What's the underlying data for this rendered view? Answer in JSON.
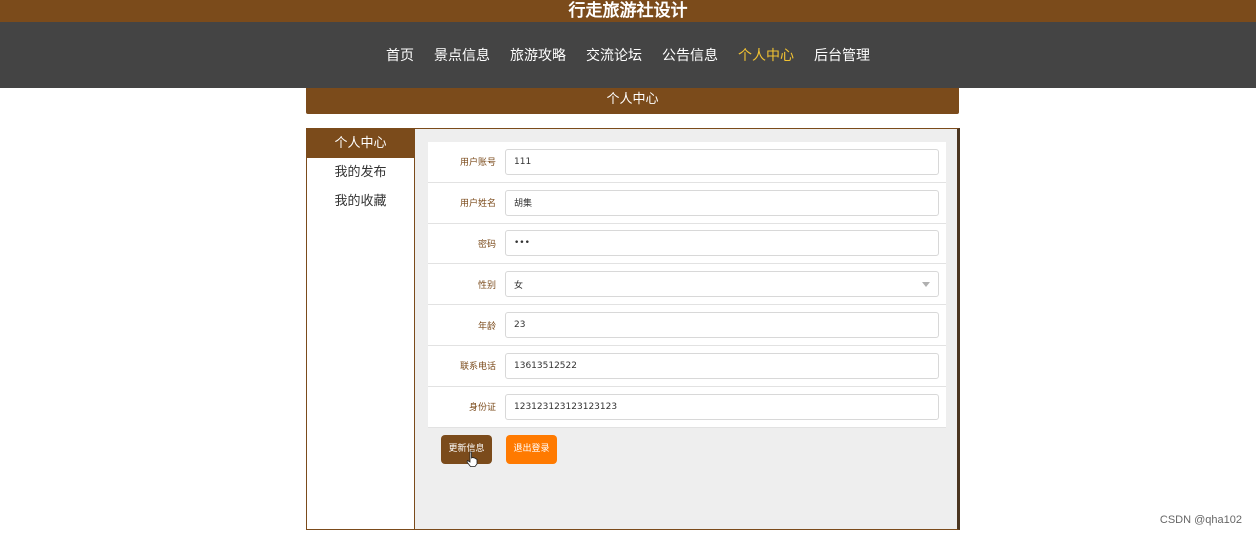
{
  "site": {
    "title": "行走旅游社设计"
  },
  "nav": {
    "items": [
      {
        "label": "首页",
        "active": false
      },
      {
        "label": "景点信息",
        "active": false
      },
      {
        "label": "旅游攻略",
        "active": false
      },
      {
        "label": "交流论坛",
        "active": false
      },
      {
        "label": "公告信息",
        "active": false
      },
      {
        "label": "个人中心",
        "active": true
      },
      {
        "label": "后台管理",
        "active": false
      }
    ]
  },
  "section": {
    "title": "个人中心"
  },
  "sidebar": {
    "items": [
      {
        "label": "个人中心",
        "active": true
      },
      {
        "label": "我的发布",
        "active": false
      },
      {
        "label": "我的收藏",
        "active": false
      }
    ]
  },
  "form": {
    "fields": [
      {
        "label": "用户账号",
        "value": "111"
      },
      {
        "label": "用户姓名",
        "value": "胡集"
      },
      {
        "label": "密码",
        "value": "•••"
      },
      {
        "label": "性别",
        "value": "女"
      },
      {
        "label": "年龄",
        "value": "23"
      },
      {
        "label": "联系电话",
        "value": "13613512522"
      },
      {
        "label": "身份证",
        "value": "123123123123123123"
      }
    ],
    "update_label": "更新信息",
    "logout_label": "退出登录"
  },
  "watermark": "CSDN @qha102",
  "colors": {
    "brand": "#7b4b1b",
    "navbar": "#444444",
    "active_nav": "#f1c232",
    "logout": "#ff7a00"
  }
}
